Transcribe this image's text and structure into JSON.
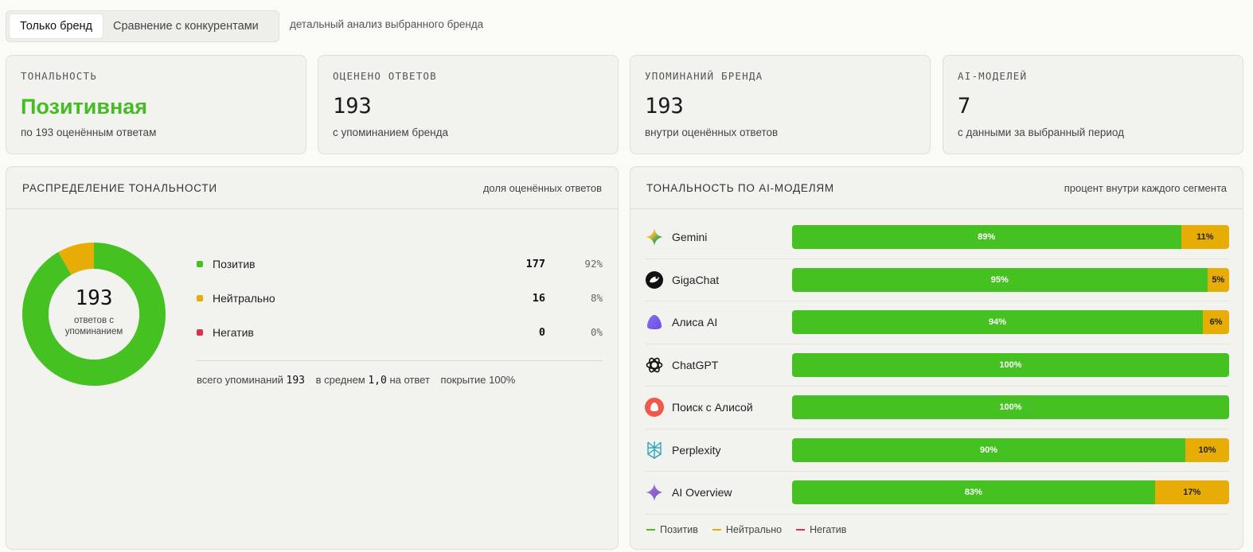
{
  "toggle": {
    "options": [
      "Только бренд",
      "Сравнение с конкурентами"
    ],
    "hint": "детальный анализ выбранного бренда"
  },
  "stats": [
    {
      "label": "ТОНАЛЬНОСТЬ",
      "value": "Позитивная",
      "sub": "по 193 оценённым ответам"
    },
    {
      "label": "ОЦЕНЕНО ОТВЕТОВ",
      "value": "193",
      "sub": "с упоминанием бренда"
    },
    {
      "label": "УПОМИНАНИЙ БРЕНДА",
      "value": "193",
      "sub": "внутри оценённых ответов"
    },
    {
      "label": "AI-МОДЕЛЕЙ",
      "value": "7",
      "sub": "с данными за выбранный период"
    }
  ],
  "distribution": {
    "title": "РАСПРЕДЕЛЕНИЕ ТОНАЛЬНОСТИ",
    "hint": "доля оценённых ответов",
    "center_value": "193",
    "center_label": "ответов с упоминанием",
    "rows": [
      {
        "name": "Позитив",
        "count": "177",
        "pct": "92%",
        "color": "#45c121"
      },
      {
        "name": "Нейтрально",
        "count": "16",
        "pct": "8%",
        "color": "#e8ac06"
      },
      {
        "name": "Негатив",
        "count": "0",
        "pct": "0%",
        "color": "#d9344a"
      }
    ],
    "totals": {
      "mentions_label": "всего упоминаний",
      "mentions_value": "193",
      "avg_label": "в среднем",
      "avg_value": "1,0",
      "avg_suffix": "на ответ",
      "coverage": "покрытие 100%"
    }
  },
  "models": {
    "title": "ТОНАЛЬНОСТЬ ПО AI-МОДЕЛЯМ",
    "hint": "процент внутри каждого сегмента",
    "rows": [
      {
        "name": "Gemini",
        "icon": "gemini-icon",
        "pos": 89,
        "neu": 11,
        "neg": 0
      },
      {
        "name": "GigaChat",
        "icon": "gigachat-icon",
        "pos": 95,
        "neu": 5,
        "neg": 0
      },
      {
        "name": "Алиса AI",
        "icon": "alice-icon",
        "pos": 94,
        "neu": 6,
        "neg": 0
      },
      {
        "name": "ChatGPT",
        "icon": "chatgpt-icon",
        "pos": 100,
        "neu": 0,
        "neg": 0
      },
      {
        "name": "Поиск с Алисой",
        "icon": "alice-search-icon",
        "pos": 100,
        "neu": 0,
        "neg": 0
      },
      {
        "name": "Perplexity",
        "icon": "perplexity-icon",
        "pos": 90,
        "neu": 10,
        "neg": 0
      },
      {
        "name": "AI Overview",
        "icon": "ai-overview-icon",
        "pos": 83,
        "neu": 17,
        "neg": 0
      }
    ],
    "legend": [
      "Позитив",
      "Нейтрально",
      "Негатив"
    ]
  },
  "colors": {
    "positive": "#45c121",
    "neutral": "#e8ac06",
    "negative": "#d9344a"
  },
  "chart_data": [
    {
      "type": "pie",
      "categories": [
        "Позитив",
        "Нейтрально",
        "Негатив"
      ],
      "values": [
        177,
        16,
        0
      ]
    },
    {
      "type": "bar",
      "stacked": true,
      "orientation": "horizontal",
      "categories": [
        "Gemini",
        "GigaChat",
        "Алиса AI",
        "ChatGPT",
        "Поиск с Алисой",
        "Perplexity",
        "AI Overview"
      ],
      "series": [
        {
          "name": "Позитив",
          "values": [
            89,
            95,
            94,
            100,
            100,
            90,
            83
          ]
        },
        {
          "name": "Нейтрально",
          "values": [
            11,
            5,
            6,
            0,
            0,
            10,
            17
          ]
        },
        {
          "name": "Негатив",
          "values": [
            0,
            0,
            0,
            0,
            0,
            0,
            0
          ]
        }
      ],
      "ylim": [
        0,
        100
      ]
    }
  ]
}
